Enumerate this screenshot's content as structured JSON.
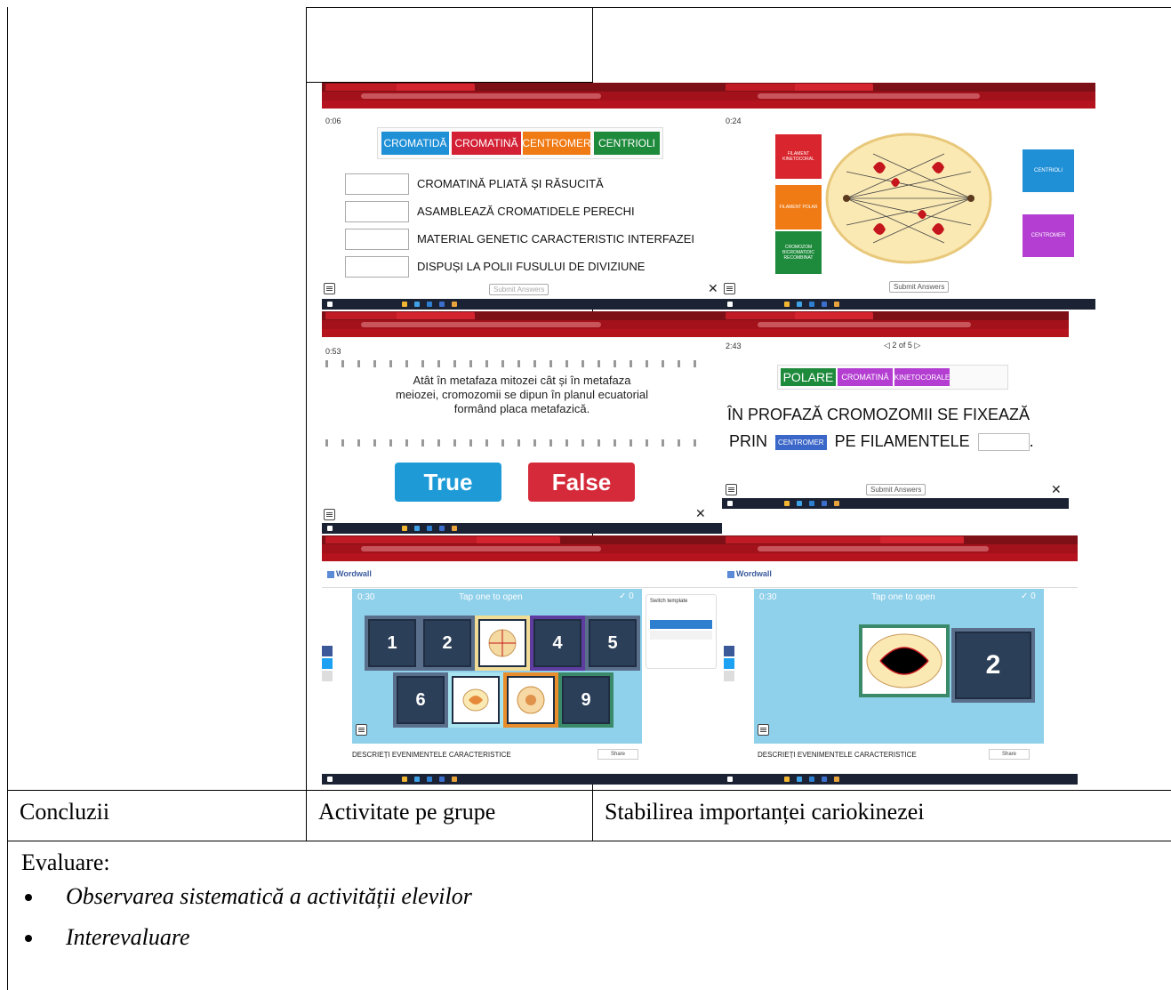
{
  "table": {
    "row_concluzii": {
      "col1": "Concluzii",
      "col2": "Activitate pe grupe",
      "col3": "Stabilirea importanței cariokinezei"
    },
    "evaluare": {
      "heading": "Evaluare:",
      "bullets": [
        "Observarea sistematică a activității elevilor",
        "Interevaluare"
      ]
    }
  },
  "shot1": {
    "timer": "0:06",
    "tags": [
      "CROMATIDĂ",
      "CROMATINĂ",
      "CENTROMER",
      "CENTRIOLI"
    ],
    "tag_colors": [
      "#1f8fd6",
      "#d32035",
      "#f07a14",
      "#1e8a3c"
    ],
    "rows": [
      "CROMATINĂ PLIATĂ ȘI RĂSUCITĂ",
      "ASAMBLEAZĂ CROMATIDELE PERECHI",
      "MATERIAL GENETIC CARACTERISTIC INTERFAZEI",
      "DISPUȘI LA POLII FUSULUI DE DIVIZIUNE"
    ],
    "submit": "Submit Answers"
  },
  "shot2": {
    "timer": "0:24",
    "labels_left": [
      "FILAMENT KINETOCORAL",
      "FILAMENT POLAR",
      "CROMOZOM BICROMATIDIC RECOMBINAT"
    ],
    "labels_right": [
      "CENTRIOLI",
      "CENTROMER"
    ],
    "submit": "Submit Answers"
  },
  "shot3": {
    "timer": "0:53",
    "statement": "Atât în metafaza mitozei cât și în metafaza meiozei, cromozomii se dipun în planul ecuatorial formând placa metafazică.",
    "true_label": "True",
    "false_label": "False"
  },
  "shot4": {
    "timer": "2:43",
    "pager": "2 of 5",
    "tags": [
      "POLARE",
      "CROMATINĂ",
      "KINETOCORALE"
    ],
    "line1": "ÎN PROFAZĂ CROMOZOMII SE FIXEAZĂ",
    "line2_prefix": "PRIN",
    "chip": "CENTROMER",
    "line2_mid": "PE FILAMENTELE",
    "line2_end": ".",
    "submit": "Submit Answers"
  },
  "shot5": {
    "brand": "Wordwall",
    "timer": "0:30",
    "tap": "Tap one to open",
    "tiles": [
      "1",
      "2",
      "4",
      "5",
      "6",
      "9"
    ],
    "switch_template": "Switch template",
    "title": "DESCRIEȚI EVENIMENTELE CARACTERISTICE",
    "share": "Share"
  },
  "shot6": {
    "brand": "Wordwall",
    "timer": "0:30",
    "tap": "Tap one to open",
    "tile": "2",
    "title": "DESCRIEȚI EVENIMENTELE CARACTERISTICE",
    "share": "Share"
  },
  "colors": {
    "chrome_red": "#a3111b",
    "wordwall_sky": "#8fd0ea",
    "true_blue": "#1e9bd7",
    "false_red": "#d52a3a"
  }
}
